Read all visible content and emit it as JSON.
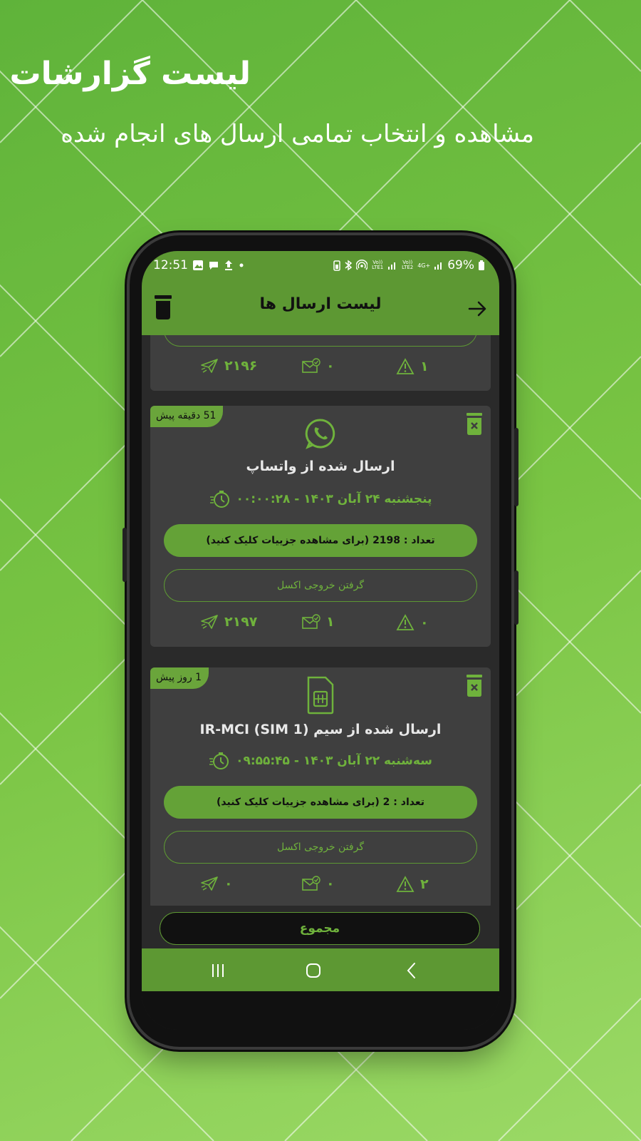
{
  "promo": {
    "title": "لیست گزارشات",
    "subtitle": "مشاهده و انتخاب تمامی ارسال های انجام شده"
  },
  "status_bar": {
    "time": "12:51",
    "battery": "69%",
    "left_icons": [
      "image-icon",
      "chat-icon",
      "upload-icon",
      "dot-icon"
    ],
    "right_icons": [
      "battery-saver-icon",
      "bluetooth-icon",
      "hotspot-icon",
      "volte1-icon",
      "signal-icon",
      "volte2-icon",
      "signal-icon",
      "4g-icon",
      "signal-icon"
    ],
    "volte1": "Vo)) LTE1",
    "volte2": "Vo)) LTE2",
    "net": "4G+"
  },
  "app_bar": {
    "title": "لیست ارسال ها"
  },
  "cards": [
    {
      "partial": true,
      "stats": {
        "sent": "۲۱۹۶",
        "delivered": "۰",
        "failed": "۱"
      }
    },
    {
      "badge": "51 دقیقه پیش",
      "icon": "whatsapp-icon",
      "title": "ارسال شده از واتساپ",
      "date": "پنجشنبه ۲۴ آبان ۱۴۰۳ - ۰۰:۰۰:۲۸",
      "count_label": "تعداد :  2198  (برای مشاهده جزییات کلیک کنید)",
      "excel_label": "گرفتن خروجی اکسل",
      "stats": {
        "sent": "۲۱۹۷",
        "delivered": "۱",
        "failed": "۰"
      }
    },
    {
      "badge": "1 روز پیش",
      "icon": "sim-card-icon",
      "title": "ارسال شده از سیم (IR-MCI (SIM 1",
      "date": "سه‌شنبه ۲۲ آبان ۱۴۰۳ - ۰۹:۵۵:۴۵",
      "count_label": "تعداد :  2  (برای مشاهده جزییات کلیک کنید)",
      "excel_label": "گرفتن خروجی اکسل",
      "stats": {
        "sent": "۰",
        "delivered": "۰",
        "failed": "۲"
      }
    }
  ],
  "total_button": "مجموع",
  "colors": {
    "accent": "#5d9833",
    "accent_text": "#6fb23c",
    "card_bg": "#3f3f3f",
    "screen_bg": "#2a2a2a"
  }
}
